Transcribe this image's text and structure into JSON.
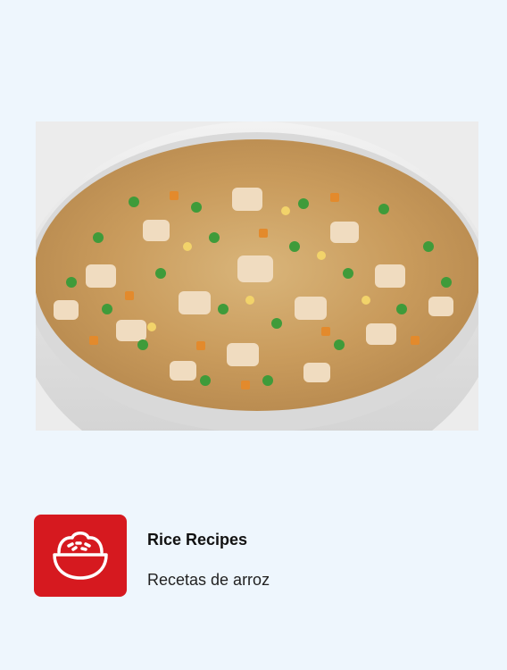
{
  "photo": {
    "icon": "fried-rice-in-cooker-photo"
  },
  "recipe": {
    "title": "Rice Recipes",
    "subtitle": "Recetas de arroz",
    "icon": "rice-bowl-icon",
    "accent_color": "#d6191f"
  }
}
